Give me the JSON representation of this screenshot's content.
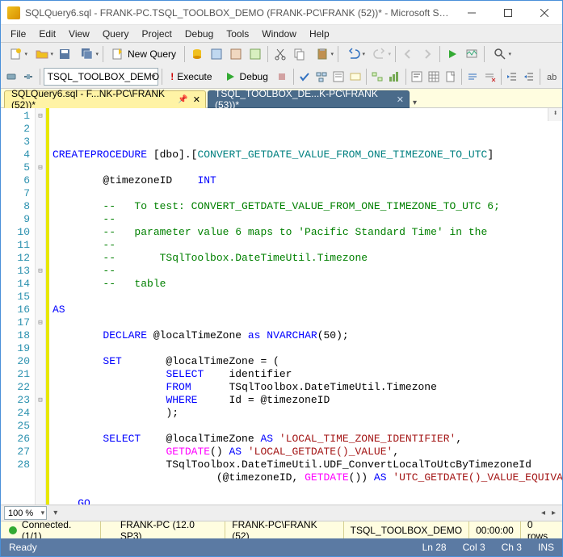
{
  "window": {
    "title": "SQLQuery6.sql - FRANK-PC.TSQL_TOOLBOX_DEMO (FRANK-PC\\FRANK (52))* - Microsoft SQL Ser..."
  },
  "menu": {
    "items": [
      "File",
      "Edit",
      "View",
      "Query",
      "Project",
      "Debug",
      "Tools",
      "Window",
      "Help"
    ]
  },
  "toolbar": {
    "new_query": "New Query",
    "db_combo": "TSQL_TOOLBOX_DEMO",
    "execute": "Execute",
    "debug": "Debug"
  },
  "tabs": [
    {
      "label": "SQLQuery6.sql - F...NK-PC\\FRANK (52))*",
      "active": true
    },
    {
      "label": "TSQL_TOOLBOX_DE...K-PC\\FRANK (53))*",
      "active": false
    }
  ],
  "code": {
    "lines": [
      {
        "n": 1,
        "fold": "⊟",
        "seg": [
          [
            "kw",
            "CREATE"
          ],
          [
            "",
            ""
          ],
          [
            "kw",
            "PROCEDURE"
          ],
          [
            "",
            " [dbo]"
          ],
          [
            "",
            ".["
          ],
          [
            "obj",
            "CONVERT_GETDATE_VALUE_FROM_ONE_TIMEZONE_TO_UTC"
          ],
          [
            "",
            "]"
          ]
        ]
      },
      {
        "n": 2,
        "seg": [
          [
            "",
            ""
          ]
        ]
      },
      {
        "n": 3,
        "seg": [
          [
            "",
            "        @timezoneID    "
          ],
          [
            "kw",
            "INT"
          ]
        ]
      },
      {
        "n": 4,
        "seg": [
          [
            "",
            ""
          ]
        ]
      },
      {
        "n": 5,
        "fold": "⊟",
        "seg": [
          [
            "com",
            "        --   To test: CONVERT_GETDATE_VALUE_FROM_ONE_TIMEZONE_TO_UTC 6;"
          ]
        ]
      },
      {
        "n": 6,
        "seg": [
          [
            "com",
            "        --"
          ]
        ]
      },
      {
        "n": 7,
        "seg": [
          [
            "com",
            "        --   parameter value 6 maps to 'Pacific Standard Time' in the"
          ]
        ]
      },
      {
        "n": 8,
        "seg": [
          [
            "com",
            "        --"
          ]
        ]
      },
      {
        "n": 9,
        "seg": [
          [
            "com",
            "        --       TSqlToolbox.DateTimeUtil.Timezone"
          ]
        ]
      },
      {
        "n": 10,
        "seg": [
          [
            "com",
            "        --"
          ]
        ]
      },
      {
        "n": 11,
        "seg": [
          [
            "com",
            "        --   table"
          ]
        ]
      },
      {
        "n": 12,
        "seg": [
          [
            "",
            ""
          ]
        ]
      },
      {
        "n": 13,
        "fold": "⊟",
        "seg": [
          [
            "kw",
            "AS"
          ]
        ]
      },
      {
        "n": 14,
        "seg": [
          [
            "",
            ""
          ]
        ]
      },
      {
        "n": 15,
        "seg": [
          [
            "",
            "        "
          ],
          [
            "kw",
            "DECLARE"
          ],
          [
            "",
            " @localTimeZone "
          ],
          [
            "kw",
            "as"
          ],
          [
            "",
            " "
          ],
          [
            "kw",
            "NVARCHAR"
          ],
          [
            "",
            "("
          ],
          [
            "",
            "50"
          ],
          [
            "",
            ")"
          ],
          [
            "",
            ";"
          ]
        ]
      },
      {
        "n": 16,
        "seg": [
          [
            "",
            ""
          ]
        ]
      },
      {
        "n": 17,
        "fold": "⊟",
        "seg": [
          [
            "",
            "        "
          ],
          [
            "kw",
            "SET"
          ],
          [
            "",
            "       @localTimeZone "
          ],
          [
            "",
            ""
          ],
          [
            "",
            "= ("
          ]
        ]
      },
      {
        "n": 18,
        "seg": [
          [
            "",
            "                  "
          ],
          [
            "kw",
            "SELECT"
          ],
          [
            "",
            "    identifier"
          ]
        ]
      },
      {
        "n": 19,
        "seg": [
          [
            "",
            "                  "
          ],
          [
            "kw",
            "FROM"
          ],
          [
            "",
            "      TSqlToolbox"
          ],
          [
            "",
            ".DateTimeUtil"
          ],
          [
            "",
            ".Timezone"
          ]
        ]
      },
      {
        "n": 20,
        "seg": [
          [
            "",
            "                  "
          ],
          [
            "kw",
            "WHERE"
          ],
          [
            "",
            "     Id "
          ],
          [
            "",
            "= @timezoneID"
          ]
        ]
      },
      {
        "n": 21,
        "seg": [
          [
            "",
            "                  );"
          ]
        ]
      },
      {
        "n": 22,
        "seg": [
          [
            "",
            ""
          ]
        ]
      },
      {
        "n": 23,
        "fold": "⊟",
        "seg": [
          [
            "",
            "        "
          ],
          [
            "kw",
            "SELECT"
          ],
          [
            "",
            "    @localTimeZone "
          ],
          [
            "kw",
            "AS"
          ],
          [
            "",
            " "
          ],
          [
            "str",
            "'LOCAL_TIME_ZONE_IDENTIFIER'"
          ],
          [
            "",
            ","
          ]
        ]
      },
      {
        "n": 24,
        "seg": [
          [
            "",
            "                  "
          ],
          [
            "fn",
            "GETDATE"
          ],
          [
            "",
            "()"
          ],
          [
            "",
            " "
          ],
          [
            "kw",
            "AS"
          ],
          [
            "",
            " "
          ],
          [
            "str",
            "'LOCAL_GETDATE()_VALUE'"
          ],
          [
            "",
            ","
          ]
        ]
      },
      {
        "n": 25,
        "seg": [
          [
            "",
            "                  TSqlToolbox"
          ],
          [
            "",
            ".DateTimeUtil"
          ],
          [
            "",
            ".UDF_ConvertLocalToUtcByTimezoneId"
          ]
        ]
      },
      {
        "n": 26,
        "seg": [
          [
            "",
            "                          (@timezoneID"
          ],
          [
            "",
            ", "
          ],
          [
            "fn",
            "GETDATE"
          ],
          [
            "",
            "()"
          ],
          [
            "",
            ")"
          ],
          [
            "",
            " "
          ],
          [
            "kw",
            "AS"
          ],
          [
            "",
            " "
          ],
          [
            "str",
            "'UTC_GETDATE()_VALUE_EQUIVALENT'"
          ],
          [
            "",
            ";"
          ]
        ]
      },
      {
        "n": 27,
        "seg": [
          [
            "",
            ""
          ]
        ]
      },
      {
        "n": 28,
        "seg": [
          [
            "kw",
            "    GO"
          ]
        ]
      }
    ]
  },
  "zoom": {
    "value": "100 %"
  },
  "conn": {
    "status": "Connected. (1/1)",
    "server": "FRANK-PC (12.0 SP3)",
    "user": "FRANK-PC\\FRANK (52)",
    "db": "TSQL_TOOLBOX_DEMO",
    "time": "00:00:00",
    "rows": "0 rows"
  },
  "status": {
    "ready": "Ready",
    "ln": "Ln 28",
    "col": "Col 3",
    "ch": "Ch 3",
    "ins": "INS"
  }
}
